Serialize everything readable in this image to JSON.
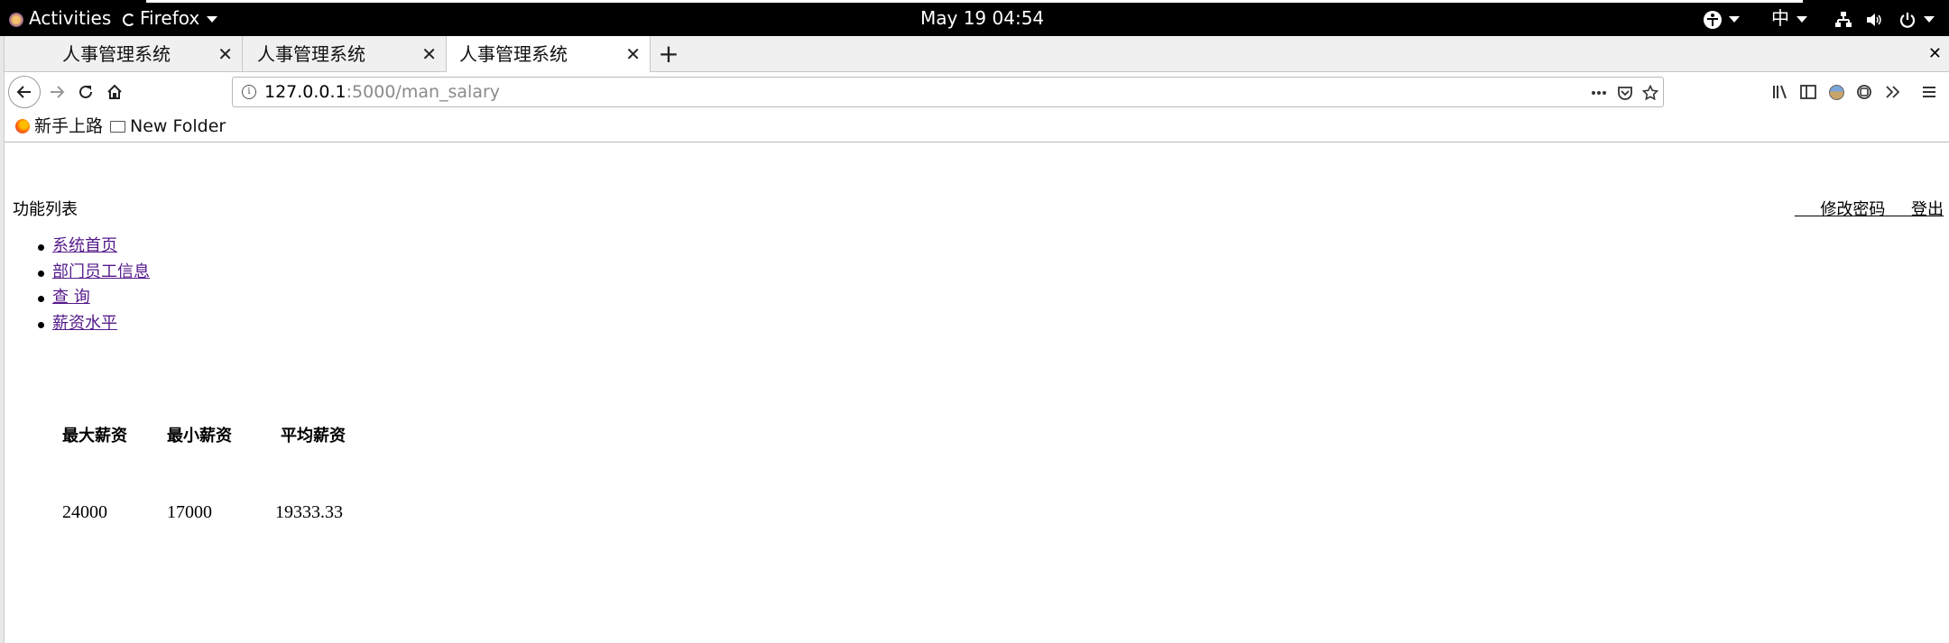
{
  "system_bar": {
    "activities": "Activities",
    "app_name": "Firefox",
    "clock": "May 19  04:54",
    "input_method": "中"
  },
  "browser": {
    "tabs": [
      {
        "title": "人事管理系统"
      },
      {
        "title": "人事管理系统"
      },
      {
        "title": "人事管理系统"
      }
    ],
    "url": {
      "host": "127.0.0.1",
      "path": ":5000/man_salary"
    },
    "bookmarks": [
      {
        "label": "新手上路",
        "icon": "firefox-icon"
      },
      {
        "label": "New Folder",
        "icon": "folder-icon"
      }
    ]
  },
  "page": {
    "function_list_title": "功能列表",
    "top_links": {
      "change_password": "修改密码",
      "logout": "登出"
    },
    "nav_items": [
      {
        "label": "系统首页"
      },
      {
        "label": "部门员工信息"
      },
      {
        "label": "查 询"
      },
      {
        "label": "薪资水平"
      }
    ],
    "salary_table": {
      "headers": [
        "最大薪资",
        "最小薪资",
        "平均薪资"
      ],
      "row": [
        "24000",
        "17000",
        "19333.33"
      ]
    }
  }
}
